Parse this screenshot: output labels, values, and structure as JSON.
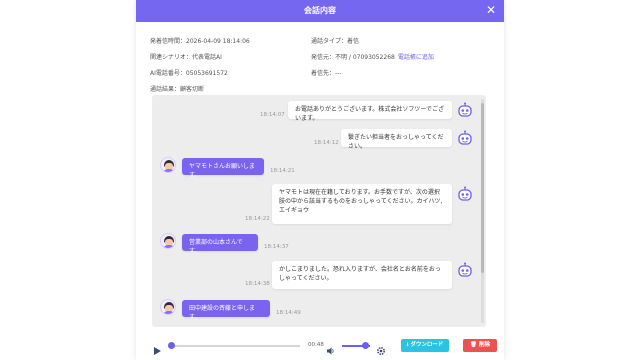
{
  "modal": {
    "title": "会話内容",
    "close": "✕"
  },
  "info": {
    "received_time": "発着信時間：2026-04-09 18:14:06",
    "call_type": "通話タイプ：着信",
    "scenario": "関連シナリオ：代表電話AI",
    "caller": "発信元：不明 / 07093052268",
    "add_to_phonebook": "電話帳に追加",
    "ai_number": "AI電話番号：05053691572",
    "destination": "着信先：---",
    "result": "通話結果：顧客切断"
  },
  "messages": [
    {
      "sender": "bot",
      "text": "お電話ありがとうございます。株式会社ソフツーでございます。",
      "time": "18:14:07"
    },
    {
      "sender": "bot",
      "text": "繋ぎたい担当者をおっしゃってください。",
      "time": "18:14:12"
    },
    {
      "sender": "user",
      "text": "ヤマモトさんお願いします。",
      "time": "18:14:21"
    },
    {
      "sender": "bot",
      "text": "ヤマモトは現在在籍しております。お手数ですが、次の選択肢の中から該当するものをおっしゃってください。カイハツ,エイギョウ",
      "time": "18:14:22"
    },
    {
      "sender": "user",
      "text": "営業部の山本さんです。",
      "time": "18:14:37"
    },
    {
      "sender": "bot",
      "text": "かしこまりました。恐れ入りますが、会社名とお名前をおっしゃってください。",
      "time": "18:14:38"
    },
    {
      "sender": "user",
      "text": "田中建設の斉藤と申します。",
      "time": "18:14:49"
    }
  ],
  "player": {
    "time": "00:48",
    "progress": 0.03,
    "volume": 0.85
  },
  "buttons": {
    "download": "ダウンロード",
    "delete": "削除"
  },
  "colors": {
    "accent": "#7567f0",
    "download": "#29c3e3",
    "delete": "#eb5353"
  },
  "icons": {
    "close": "close-icon",
    "bot": "robot-icon",
    "user": "user-avatar",
    "play": "play-icon",
    "volume": "volume-icon",
    "settings": "gear-icon",
    "download": "download-icon",
    "delete": "trash-icon"
  }
}
